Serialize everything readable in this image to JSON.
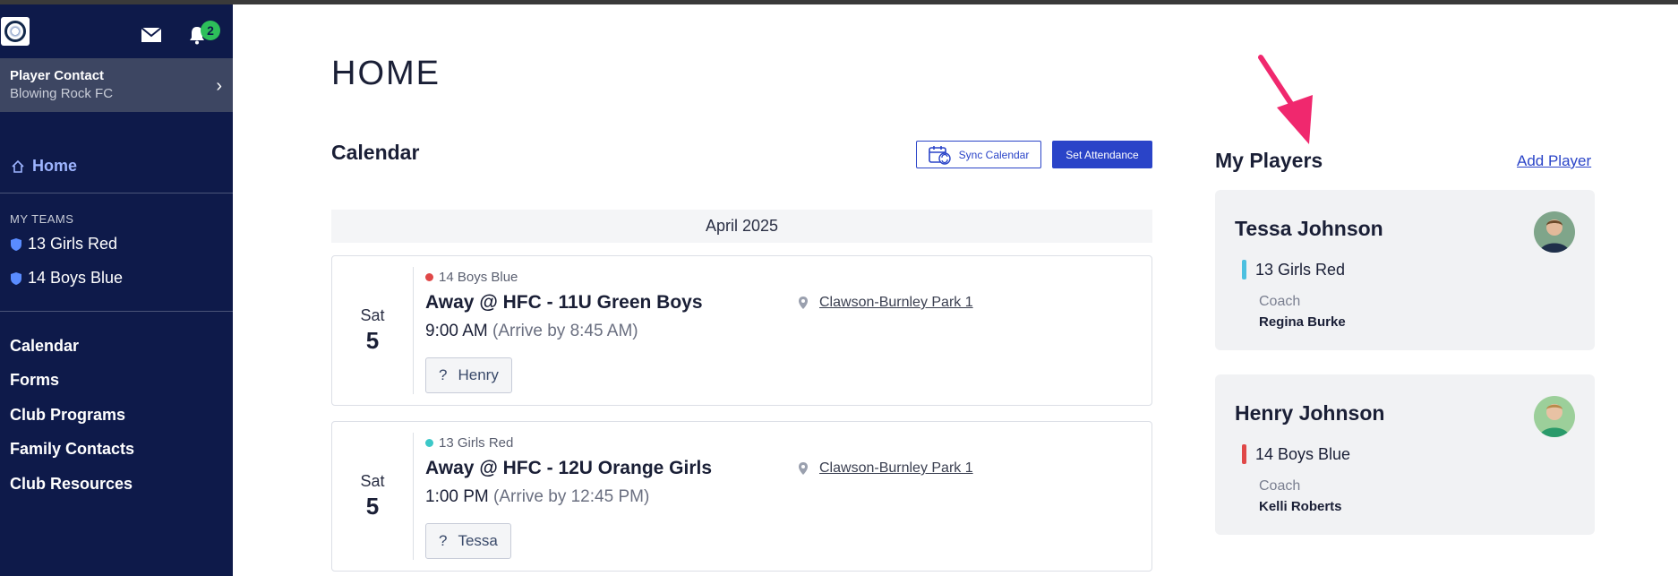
{
  "sidebar": {
    "badge_count": "2",
    "contact": {
      "role": "Player Contact",
      "club": "Blowing Rock FC"
    },
    "home_label": "Home",
    "my_teams_label": "MY TEAMS",
    "teams": [
      {
        "label": "13 Girls Red"
      },
      {
        "label": "14 Boys Blue"
      }
    ],
    "menu": [
      {
        "label": "Calendar"
      },
      {
        "label": "Forms"
      },
      {
        "label": "Club Programs"
      },
      {
        "label": "Family Contacts"
      },
      {
        "label": "Club Resources"
      }
    ]
  },
  "main": {
    "title": "HOME",
    "calendar": {
      "title": "Calendar",
      "sync_label": "Sync Calendar",
      "attendance_label": "Set Attendance",
      "month": "April 2025",
      "events": [
        {
          "dow": "Sat",
          "date": "5",
          "team": "14 Boys Blue",
          "team_color": "#e04848",
          "name": "Away @ HFC - 11U Green Boys",
          "time": "9:00 AM",
          "arrive": "(Arrive by 8:45 AM)",
          "location": "Clawson-Burnley Park 1",
          "player": "Henry",
          "status": "?"
        },
        {
          "dow": "Sat",
          "date": "5",
          "team": "13 Girls Red",
          "team_color": "#3cc8c8",
          "name": "Away @ HFC - 12U Orange Girls",
          "time": "1:00 PM",
          "arrive": "(Arrive by 12:45 PM)",
          "location": "Clawson-Burnley Park 1",
          "player": "Tessa",
          "status": "?"
        }
      ]
    },
    "players": {
      "title": "My Players",
      "add_label": "Add Player",
      "list": [
        {
          "name": "Tessa Johnson",
          "team": "13 Girls Red",
          "team_color": "#4cc0e0",
          "coach_label": "Coach",
          "coach": "Regina Burke"
        },
        {
          "name": "Henry Johnson",
          "team": "14 Boys Blue",
          "team_color": "#e04848",
          "coach_label": "Coach",
          "coach": "Kelli Roberts"
        }
      ]
    }
  },
  "colors": {
    "sidebar_bg": "#0e1a4a",
    "accent": "#2a44c8",
    "pointer": "#f0286e"
  }
}
